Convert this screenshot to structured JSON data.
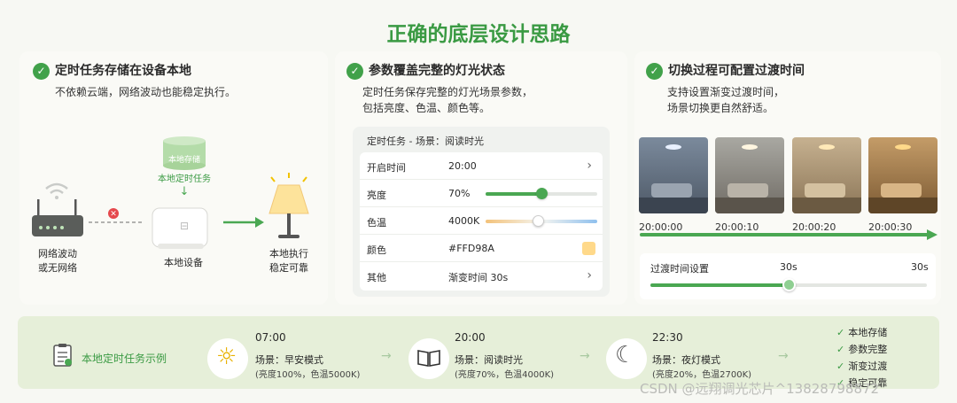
{
  "title": "正确的底层设计思路",
  "col1": {
    "heading": "定时任务存储在设备本地",
    "desc": "不依赖云端，网络波动也能稳定执行。",
    "storage_text": "本地存储",
    "storage_label": "本地定时任务",
    "router_label_1": "网络波动",
    "router_label_2": "或无网络",
    "device_label": "本地设备",
    "lamp_label_1": "本地执行",
    "lamp_label_2": "稳定可靠"
  },
  "col2": {
    "heading": "参数覆盖完整的灯光状态",
    "desc1": "定时任务保存完整的灯光场景参数，",
    "desc2": "包括亮度、色温、颜色等。",
    "card_title": "定时任务 - 场景：阅读时光",
    "rows": [
      {
        "key": "开启时间",
        "value": "20:00"
      },
      {
        "key": "亮度",
        "value": "70%",
        "level": 0.5
      },
      {
        "key": "色温",
        "value": "4000K",
        "level": 0.47
      },
      {
        "key": "颜色",
        "value": "#FFD98A"
      },
      {
        "key": "其他",
        "value": "渐变时间 30s"
      }
    ],
    "swatch_color": "#FFD98A"
  },
  "col3": {
    "heading": "切换过程可配置过渡时间",
    "desc1": "支持设置渐变过渡时间，",
    "desc2": "场景切换更自然舒适。",
    "times": [
      "20:00:00",
      "20:00:10",
      "20:00:20",
      "20:00:30"
    ],
    "trans_label": "过渡时间设置",
    "trans_value": "30s",
    "trans_max": "30s",
    "trans_level": 0.5
  },
  "bottom": {
    "title": "本地定时任务示例",
    "steps": [
      {
        "time": "07:00",
        "scene": "场景：早安模式",
        "params": "(亮度100%，色温5000K)"
      },
      {
        "time": "20:00",
        "scene": "场景：阅读时光",
        "params": "(亮度70%，色温4000K)"
      },
      {
        "time": "22:30",
        "scene": "场景：夜灯模式",
        "params": "(亮度20%，色温2700K)"
      }
    ],
    "features": [
      "本地存储",
      "参数完整",
      "渐变过渡",
      "稳定可靠"
    ]
  },
  "watermark": "CSDN @远翔调光芯片^13828798872",
  "colors": {
    "accent": "#3a9a43",
    "light": "#ffd98a"
  }
}
